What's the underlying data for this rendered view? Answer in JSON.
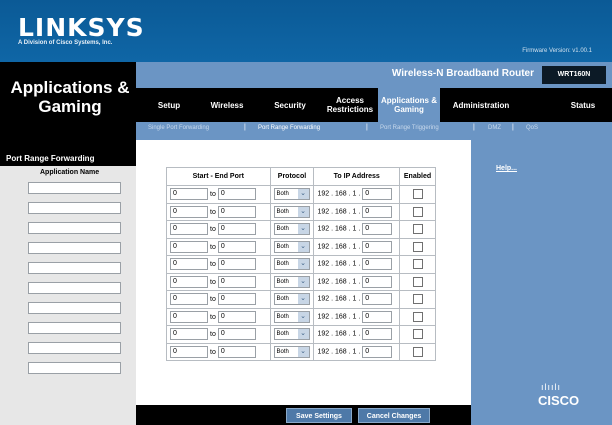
{
  "brand": {
    "logo": "LINKSYS",
    "tagline": "A Division of Cisco Systems, Inc.",
    "firmware": "Firmware Version: v1.00.1"
  },
  "section_title": "Applications & Gaming",
  "product": {
    "name": "Wireless-N Broadband Router",
    "model": "WRT160N"
  },
  "tabs": [
    {
      "label": "Setup"
    },
    {
      "label": "Wireless"
    },
    {
      "label": "Security"
    },
    {
      "label": "Access Restrictions"
    },
    {
      "label": "Applications & Gaming"
    },
    {
      "label": "Administration"
    },
    {
      "label": "Status"
    }
  ],
  "subtabs": [
    {
      "label": "Single Port Forwarding"
    },
    {
      "label": "Port Range Forwarding"
    },
    {
      "label": "Port Range Triggering"
    },
    {
      "label": "DMZ"
    },
    {
      "label": "QoS"
    }
  ],
  "left": {
    "heading": "Port Range Forwarding",
    "app_name_label": "Application Name"
  },
  "table": {
    "headers": {
      "ports": "Start - End Port",
      "protocol": "Protocol",
      "ip": "To IP Address",
      "enabled": "Enabled"
    },
    "to_label": "to",
    "ip_prefix": "192 . 168 . 1 .",
    "rows": [
      {
        "start": "0",
        "end": "0",
        "protocol": "Both",
        "ip_last": "0",
        "enabled": false
      },
      {
        "start": "0",
        "end": "0",
        "protocol": "Both",
        "ip_last": "0",
        "enabled": false
      },
      {
        "start": "0",
        "end": "0",
        "protocol": "Both",
        "ip_last": "0",
        "enabled": false
      },
      {
        "start": "0",
        "end": "0",
        "protocol": "Both",
        "ip_last": "0",
        "enabled": false
      },
      {
        "start": "0",
        "end": "0",
        "protocol": "Both",
        "ip_last": "0",
        "enabled": false
      },
      {
        "start": "0",
        "end": "0",
        "protocol": "Both",
        "ip_last": "0",
        "enabled": false
      },
      {
        "start": "0",
        "end": "0",
        "protocol": "Both",
        "ip_last": "0",
        "enabled": false
      },
      {
        "start": "0",
        "end": "0",
        "protocol": "Both",
        "ip_last": "0",
        "enabled": false
      },
      {
        "start": "0",
        "end": "0",
        "protocol": "Both",
        "ip_last": "0",
        "enabled": false
      },
      {
        "start": "0",
        "end": "0",
        "protocol": "Both",
        "ip_last": "0",
        "enabled": false
      }
    ]
  },
  "help": "Help...",
  "buttons": {
    "save": "Save Settings",
    "cancel": "Cancel Changes"
  },
  "footer_logo": "CISCO",
  "footer_logo_bars": "ılıılı",
  "colors": {
    "brand_blue": "#0f66a6",
    "accent_blue": "#6b95c4",
    "black": "#000000"
  }
}
